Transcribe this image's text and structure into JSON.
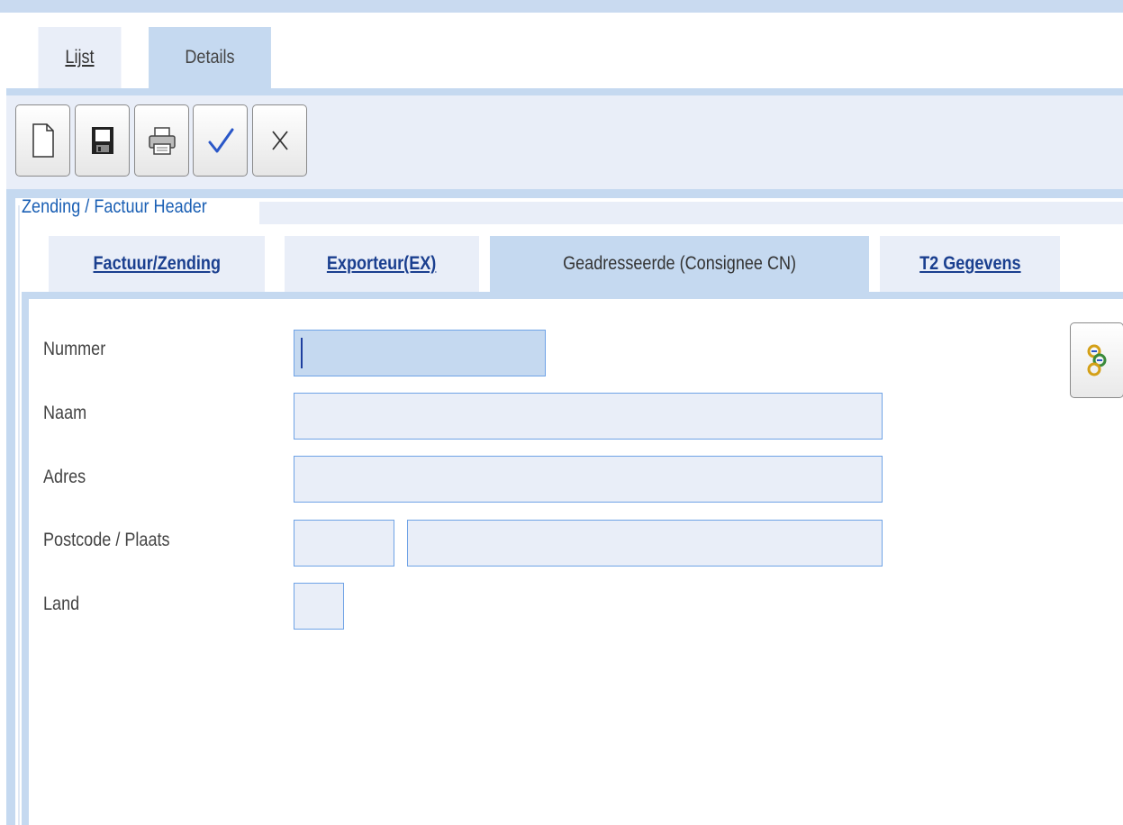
{
  "outer_tabs": {
    "list_label": "Lijst",
    "details_label": "Details"
  },
  "toolbar": {
    "new_icon": "new-document-icon",
    "save_icon": "floppy-disk-icon",
    "print_icon": "printer-icon",
    "confirm_icon": "checkmark-icon",
    "cancel_icon": "close-x-icon"
  },
  "header": {
    "legend": "Zending / Factuur Header"
  },
  "inner_tabs": [
    {
      "label": "Factuur/Zending",
      "active": false
    },
    {
      "label": "Exporteur(EX)",
      "active": false
    },
    {
      "label": "Geadresseerde (Consignee CN)",
      "active": true
    },
    {
      "label": "T2 Gegevens",
      "active": false
    }
  ],
  "form": {
    "nummer_label": "Nummer",
    "nummer_value": "",
    "naam_label": "Naam",
    "naam_value": "",
    "adres_label": "Adres",
    "adres_value": "",
    "postcode_plaats_label": "Postcode / Plaats",
    "postcode_value": "",
    "plaats_value": "",
    "land_label": "Land",
    "land_value": ""
  },
  "lookup_icon": "lookup-chain-icon",
  "colors": {
    "tab_active": "#c5d9f0",
    "tab_inactive": "#e9eef8",
    "field_border": "#6fa3e6",
    "link": "#1a3f8f",
    "legend": "#1a5fb4"
  }
}
